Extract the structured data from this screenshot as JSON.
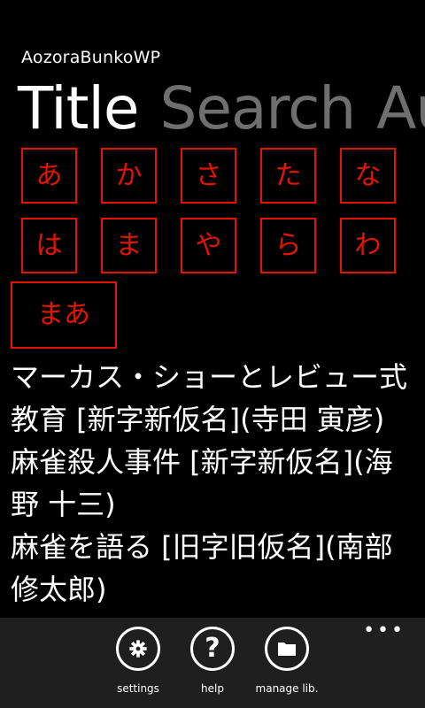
{
  "app": {
    "title": "AozoraBunkoWP"
  },
  "pivot": {
    "headers": [
      "Title",
      "Search",
      "Au"
    ]
  },
  "kana_buttons": [
    "あ",
    "か",
    "さ",
    "た",
    "な",
    "は",
    "ま",
    "や",
    "ら",
    "わ"
  ],
  "wide_button": {
    "label": "まあ"
  },
  "books": [
    "マーカス・ショーとレビュー式教育 [新字新仮名](寺田 寅彦)",
    "麻雀殺人事件 [新字新仮名](海野 十三)",
    "麻雀を語る [旧字旧仮名](南部 修太郎)"
  ],
  "appbar": {
    "more": "•••",
    "buttons": [
      {
        "label": "settings",
        "icon": "gear-icon"
      },
      {
        "label": "help",
        "icon": "question-icon"
      },
      {
        "label": "manage lib.",
        "icon": "folder-icon"
      }
    ]
  },
  "colors": {
    "accent": "#e51400",
    "background": "#000000",
    "appbar": "#1f1f1f",
    "inactive": "#6f6f6f"
  }
}
